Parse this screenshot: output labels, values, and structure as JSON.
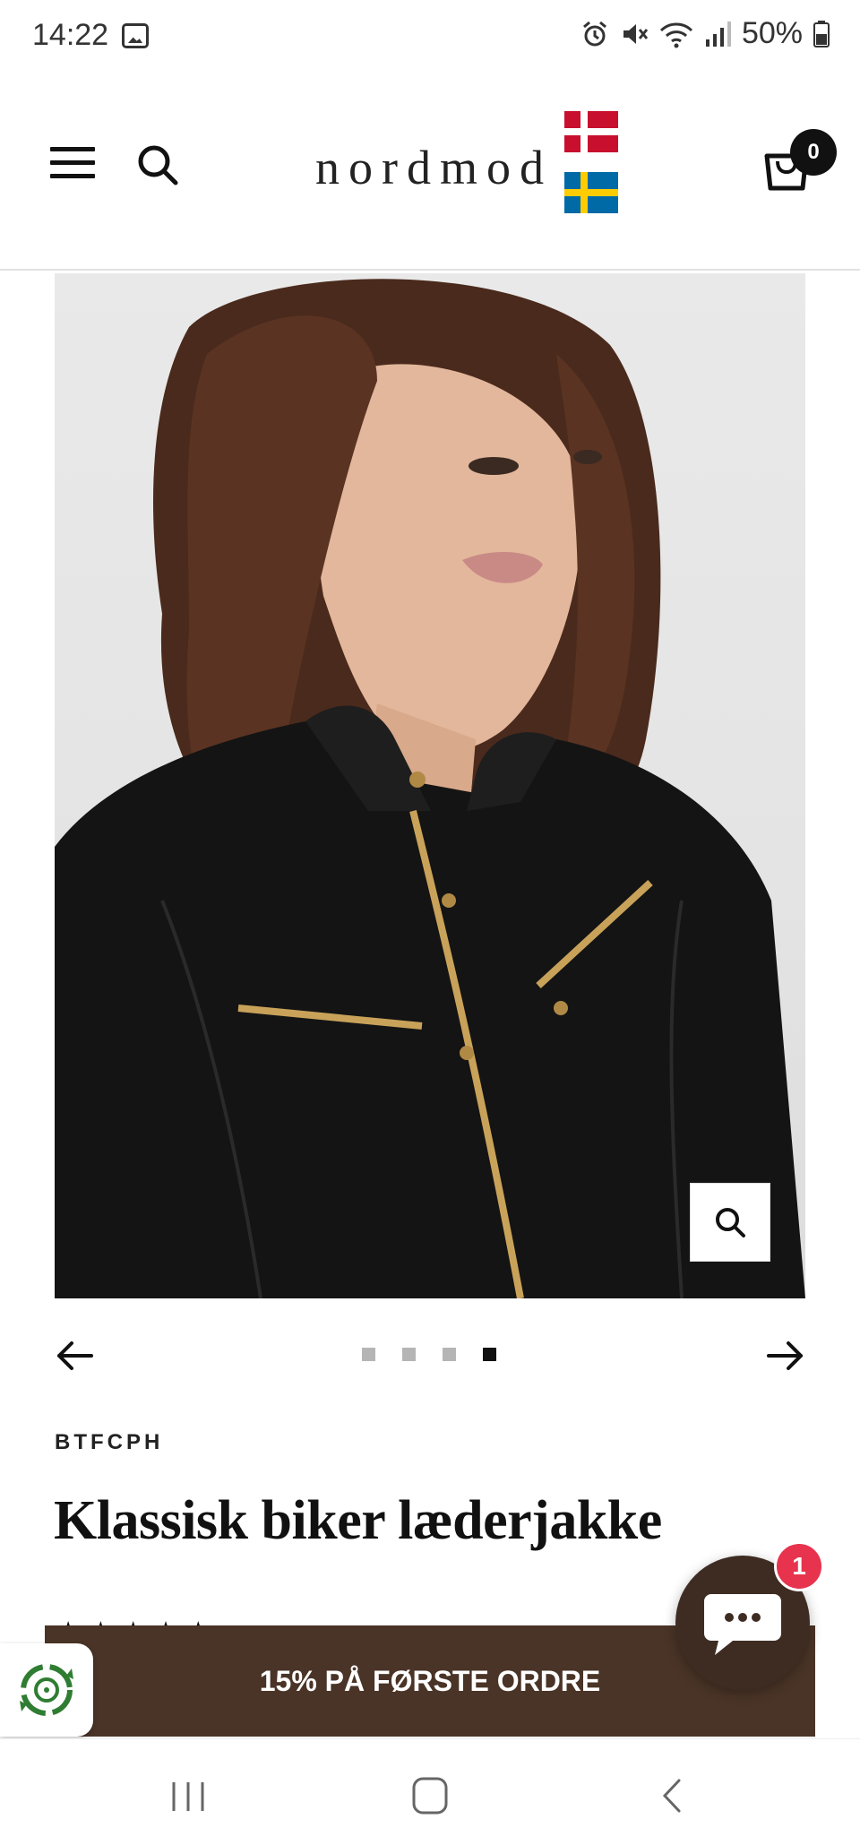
{
  "status_bar": {
    "time": "14:22",
    "battery": "50%"
  },
  "header": {
    "logo": "nordmod",
    "cart_count": "0",
    "flags": [
      "denmark-flag",
      "sweden-flag"
    ]
  },
  "gallery": {
    "image_alt": "Model wearing black leather biker jacket",
    "dot_count": 4,
    "active_dot": 4
  },
  "product": {
    "brand": "BTFCPH",
    "title": "Klassisk biker læderjakke",
    "rating_stars": "★★★★★"
  },
  "promo": {
    "label": "15% PÅ FØRSTE ORDRE"
  },
  "chat": {
    "badge": "1"
  },
  "colors": {
    "promo_bg": "#4a3427",
    "chat_bg": "#3e2c23",
    "badge_red": "#e7334d",
    "text_dark": "#111111"
  }
}
